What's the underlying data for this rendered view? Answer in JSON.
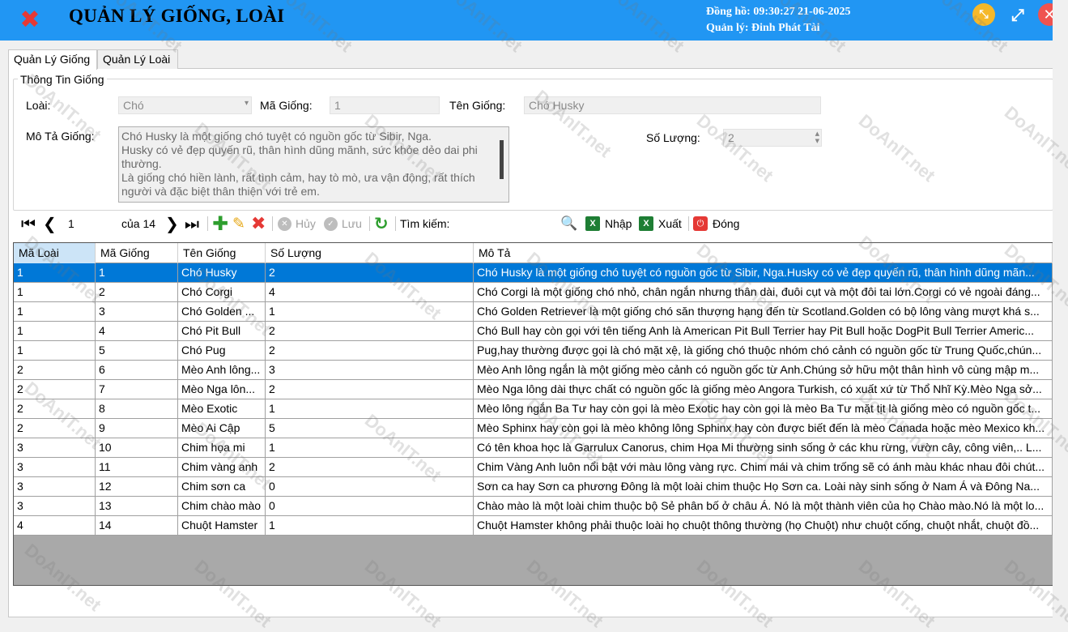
{
  "header": {
    "title": "QUẢN LÝ GIỐNG, LOÀI",
    "clock": "Đồng hồ: 09:30:27 21-06-2025",
    "manager": "Quản lý: Đinh Phát Tài"
  },
  "tabs": [
    {
      "label": "Quản Lý Giống",
      "active": true
    },
    {
      "label": "Quản Lý Loài",
      "active": false
    }
  ],
  "info": {
    "legend": "Thông Tin Giống",
    "loai_label": "Loài:",
    "loai_value": "Chó",
    "ma_label": "Mã Giống:",
    "ma_value": "1",
    "ten_label": "Tên Giống:",
    "ten_value": "Chó Husky",
    "mota_label": "Mô Tả Giống:",
    "mota_lines": [
      "Chó Husky là một giống chó tuyệt có nguồn gốc từ Sibir, Nga.",
      "Husky có vẻ đẹp quyến rũ, thân hình dũng mãnh, sức khỏe dẻo dai phi",
      "thường.",
      "Là giống chó hiền lành, rất tình cảm, hay tò mò, ưa vận động, rất thích",
      "người và đặc biệt thân thiện với trẻ em."
    ],
    "soluong_label": "Số Lượng:",
    "soluong_value": "2"
  },
  "toolbar": {
    "page_value": "1",
    "page_total": "của 14",
    "cancel_label": "Hủy",
    "save_label": "Lưu",
    "search_label": "Tìm kiếm:",
    "import_label": "Nhập",
    "export_label": "Xuất",
    "close_label": "Đóng",
    "colors": {
      "add": "#2e9e2e",
      "edit": "#e6a817",
      "delete": "#e53935",
      "refresh": "#2e9e2e"
    }
  },
  "grid": {
    "columns": [
      "Mã Loài",
      "Mã Giống",
      "Tên Giống",
      "Số Lượng",
      "Mô Tả"
    ],
    "rows": [
      [
        "1",
        "1",
        "Chó Husky",
        "2",
        "Chó Husky là một giống chó tuyệt có nguồn gốc từ Sibir, Nga.Husky có vẻ đẹp quyến rũ, thân hình dũng mãn..."
      ],
      [
        "1",
        "2",
        "Chó Corgi",
        "4",
        "Chó Corgi là một giống chó nhỏ, chân ngắn nhưng thân dài, đuôi cụt và một đôi tai lớn.Corgi có vẻ ngoài đáng..."
      ],
      [
        "1",
        "3",
        "Chó Golden ...",
        "1",
        "Chó Golden Retriever là một giống chó săn thượng hạng đến từ Scotland.Golden có bộ lông vàng mượt khá s..."
      ],
      [
        "1",
        "4",
        "Chó Pit Bull",
        "2",
        "Chó Bull hay còn gọi với tên tiếng Anh là American Pit Bull Terrier hay Pit Bull hoặc DogPit Bull Terrier Americ..."
      ],
      [
        "1",
        "5",
        "Chó Pug",
        "2",
        "Pug,hay thường được gọi là chó mặt xệ, là giống chó thuộc nhóm chó cảnh có nguồn gốc từ Trung Quốc,chún..."
      ],
      [
        "2",
        "6",
        "Mèo Anh lông...",
        "3",
        "Mèo Anh lông ngắn là một giống mèo cảnh có nguồn gốc từ Anh.Chúng sở hữu một thân hình vô cùng mập m..."
      ],
      [
        "2",
        "7",
        "Mèo Nga lôn...",
        "2",
        "Mèo Nga lông dài thực chất có nguồn gốc là giống mèo Angora Turkish, có xuất xứ từ Thổ Nhĩ Kỳ.Mèo Nga sở..."
      ],
      [
        "2",
        "8",
        "Mèo Exotic",
        "1",
        "Mèo lông ngắn Ba Tư hay còn gọi là mèo Exotic hay còn gọi là mèo Ba Tư mặt tịt là giống mèo có nguồn gốc t..."
      ],
      [
        "2",
        "9",
        "Mèo Ai Cập",
        "5",
        "Mèo Sphinx hay còn gọi là mèo không lông Sphinx hay còn được biết đến là mèo Canada hoặc mèo Mexico kh..."
      ],
      [
        "3",
        "10",
        "Chim họa mi",
        "1",
        "Có tên khoa học là Garrulux Canorus, chim Họa Mi thường sinh sống ở các khu rừng, vườn cây, công viên,.. L..."
      ],
      [
        "3",
        "11",
        "Chim vàng anh",
        "2",
        "Chim Vàng Anh luôn nổi bật với màu lông vàng rực. Chim mái và chim trống sẽ có ánh màu khác nhau đôi chút..."
      ],
      [
        "3",
        "12",
        "Chim sơn ca",
        "0",
        "Sơn ca hay Sơn ca phương Đông là một loài chim thuộc Họ Sơn ca. Loài này sinh sống ở Nam Á và Đông Na..."
      ],
      [
        "3",
        "13",
        "Chim chào mào",
        "0",
        "Chào mào là một loài chim thuộc bộ Sẻ phân bố ở châu Á. Nó là một thành viên của họ Chào mào.Nó là một lo..."
      ],
      [
        "4",
        "14",
        "Chuột Hamster",
        "1",
        "Chuột Hamster không phải thuộc loài họ chuột thông thường (họ Chuột) như chuột cống, chuột nhắt, chuột đồ..."
      ]
    ],
    "selected_row": 0,
    "colors": {
      "selected": "#0078d7",
      "sorted_header": "#cce4f7",
      "empty_area": "#a9a9a9"
    }
  },
  "watermark": "DoAnIT.net",
  "theme": {
    "header_bg": "#2196f3"
  }
}
